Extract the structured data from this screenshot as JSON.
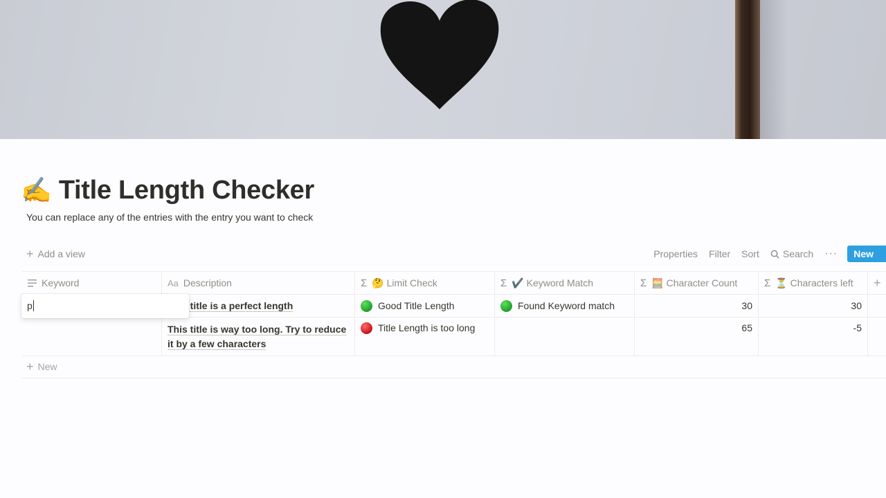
{
  "cover": {
    "icon": "heart-icon"
  },
  "page": {
    "emoji": "✍️",
    "title": "Title Length Checker",
    "subtitle": "You can replace any of the entries with the entry you want to check"
  },
  "toolbar": {
    "add_view": "Add a view",
    "properties": "Properties",
    "filter": "Filter",
    "sort": "Sort",
    "search": "Search",
    "more": "···",
    "new": "New"
  },
  "table": {
    "columns": [
      {
        "label": "Keyword",
        "icon": "text-lines-icon"
      },
      {
        "label": "Description",
        "icon": "Aa"
      },
      {
        "label": "🤔 Limit Check",
        "icon": "Σ"
      },
      {
        "label": "✔️ Keyword Match",
        "icon": "Σ"
      },
      {
        "label": "🧮 Character Count",
        "icon": "Σ"
      },
      {
        "label": "⏳ Characters left",
        "icon": "Σ"
      }
    ],
    "rows": [
      {
        "keyword": "p",
        "description": "This title is a perfect length",
        "limit_check": "Good Title Length",
        "limit_color": "#22a82b",
        "keyword_match": "Found Keyword match",
        "match_color": "#22a82b",
        "character_count": "30",
        "characters_left": "30"
      },
      {
        "keyword": "",
        "description": "This title is way too long. Try to reduce it by a few characters",
        "limit_check": "Title Length is too long",
        "limit_color": "#d6222a",
        "keyword_match": "",
        "character_count": "65",
        "characters_left": "-5"
      }
    ],
    "new_row": "New"
  },
  "editor": {
    "value": "p"
  }
}
